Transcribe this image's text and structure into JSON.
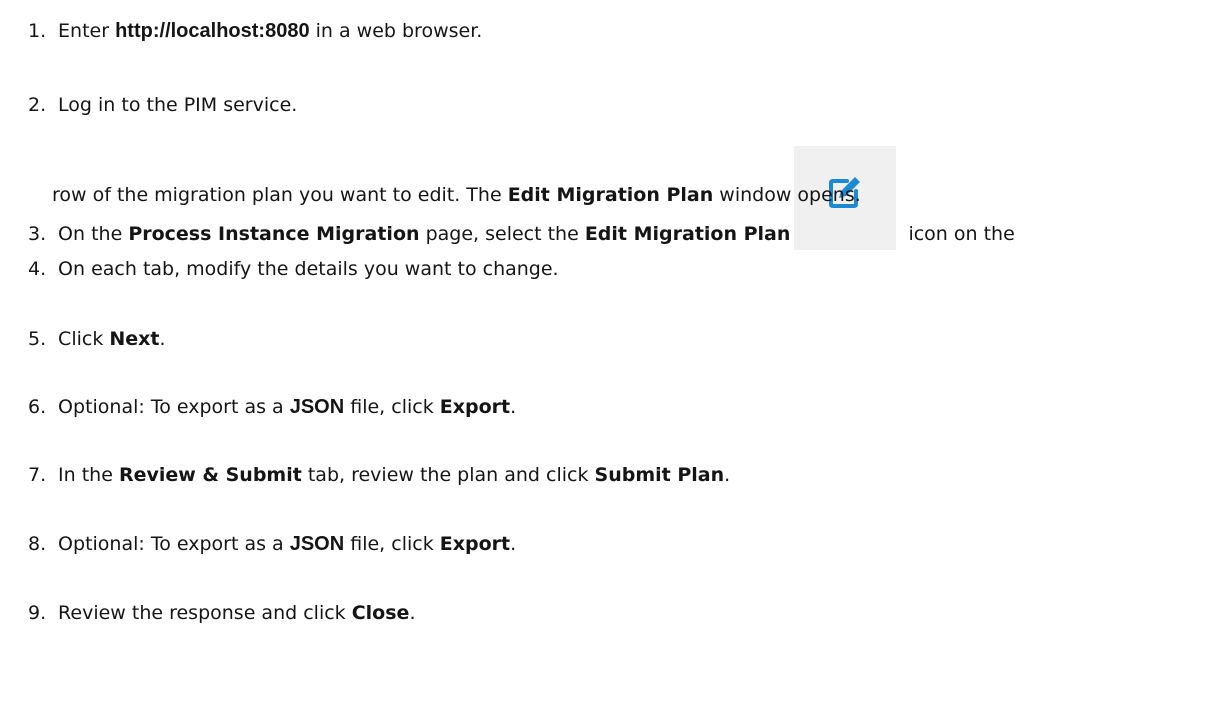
{
  "steps": [
    {
      "number": "1.",
      "text_before": "Enter ",
      "url": "http://localhost:8080",
      "text_after": " in a web browser."
    },
    {
      "number": "2.",
      "text": "Log in to the PIM service."
    },
    {
      "number": "3.",
      "text_before": "On the ",
      "page_name": "Process Instance Migration",
      "text_mid": " page, select the ",
      "icon_name": "Edit Migration Plan",
      "text_after_icon": " icon on the",
      "line2_before": "row of the migration plan you want to edit. The ",
      "window_name": "Edit Migration Plan",
      "line2_after": " window opens.",
      "icon": "edit-pencil-icon",
      "icon_color": "#1b8ad3"
    },
    {
      "number": "4.",
      "text": "On each tab, modify the details you want to change."
    },
    {
      "number": "5.",
      "text_before": "Click ",
      "button": "Next",
      "text_after": "."
    },
    {
      "number": "6.",
      "text_before": "Optional: To export as a ",
      "format": "JSON",
      "text_mid": " file, click ",
      "button": "Export",
      "text_after": "."
    },
    {
      "number": "7.",
      "text_before": "In the ",
      "tab": "Review & Submit",
      "text_mid": " tab, review the plan and click  ",
      "button": "Submit Plan",
      "text_after": "."
    },
    {
      "number": "8.",
      "text_before": "Optional: To export as a ",
      "format": "JSON",
      "text_mid": " file, click ",
      "button": "Export",
      "text_after": "."
    },
    {
      "number": "9.",
      "text_before": "Review the response and click ",
      "button": "Close",
      "text_after": "."
    }
  ]
}
